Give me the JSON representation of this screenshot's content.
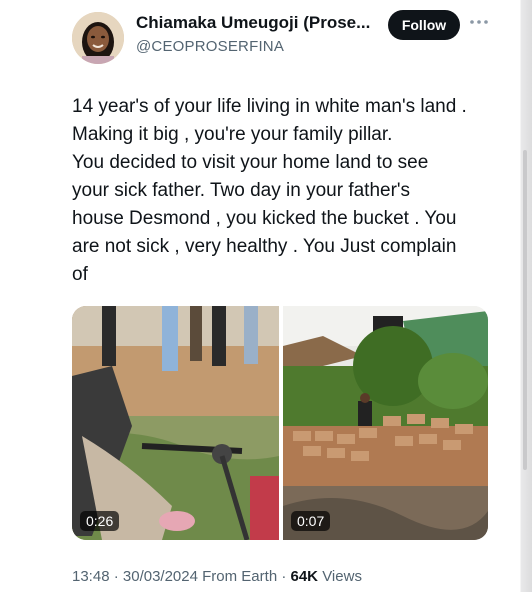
{
  "author": {
    "display_name": "Chiamaka Umeugoji (Prose...",
    "handle": "@CEOPROSERFINA"
  },
  "actions": {
    "follow_label": "Follow",
    "more_icon": "more-horizontal-icon"
  },
  "tweet": {
    "lines": [
      "14 year's of your life living in white man's land .",
      "Making it big , you're your family pillar.",
      "You decided to visit your home land to see",
      "your sick father. Two day in your father's",
      "house Desmond , you kicked the bucket . You",
      "are not sick , very healthy . You Just complain",
      "of"
    ]
  },
  "media": [
    {
      "duration": "0:26"
    },
    {
      "duration": "0:07"
    }
  ],
  "footer": {
    "time": "13:48",
    "date": "30/03/2024",
    "source": "From Earth",
    "views_count": "64K",
    "views_label": "Views"
  },
  "colors": {
    "text": "#0f1419",
    "secondary": "#536471",
    "button_bg": "#0f1419"
  }
}
